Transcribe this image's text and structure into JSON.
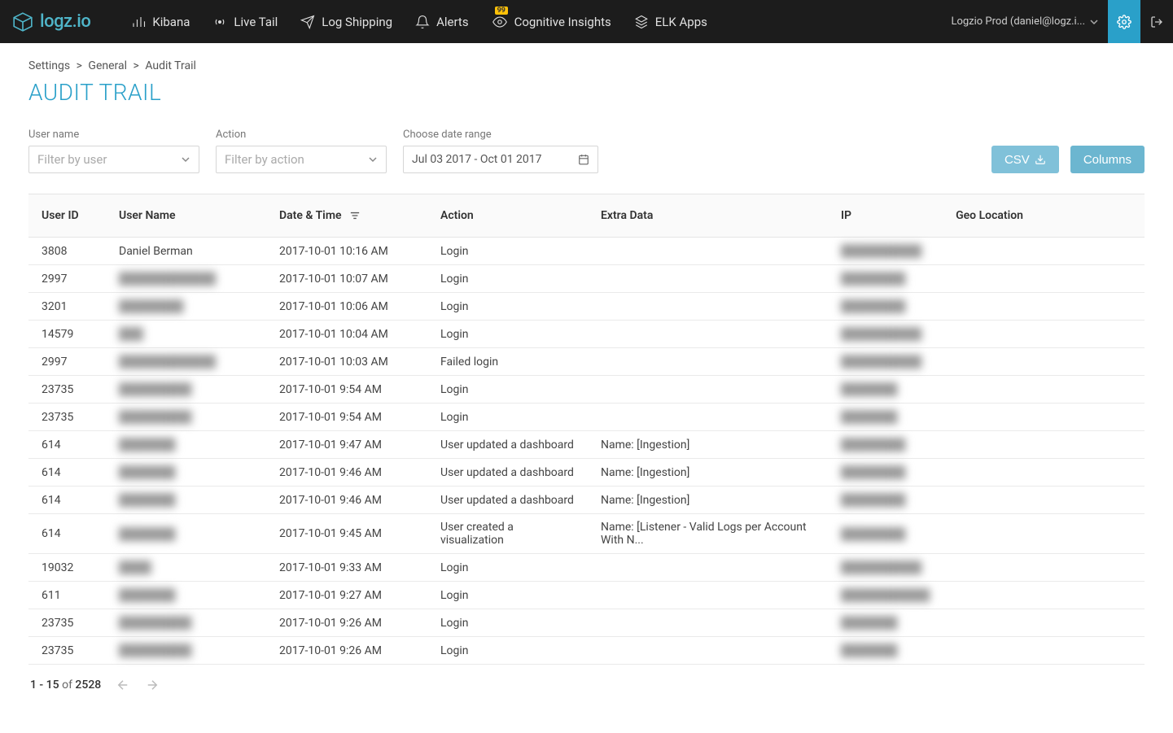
{
  "brand": "logz.io",
  "nav": {
    "items": [
      {
        "label": "Kibana"
      },
      {
        "label": "Live Tail"
      },
      {
        "label": "Log Shipping"
      },
      {
        "label": "Alerts"
      },
      {
        "label": "Cognitive Insights",
        "badge": "99"
      },
      {
        "label": "ELK Apps"
      }
    ],
    "account_label": "Logzio Prod (daniel@logz.i..."
  },
  "breadcrumb": {
    "items": [
      "Settings",
      "General",
      "Audit Trail"
    ]
  },
  "page_title": "AUDIT TRAIL",
  "filters": {
    "user_label": "User name",
    "user_placeholder": "Filter by user",
    "action_label": "Action",
    "action_placeholder": "Filter by action",
    "date_label": "Choose date range",
    "date_value": "Jul 03 2017 - Oct 01 2017"
  },
  "buttons": {
    "csv": "CSV",
    "columns": "Columns"
  },
  "table": {
    "headers": {
      "user_id": "User ID",
      "user_name": "User Name",
      "date_time": "Date & Time",
      "action": "Action",
      "extra_data": "Extra Data",
      "ip": "IP",
      "geo": "Geo Location"
    },
    "rows": [
      {
        "user_id": "3808",
        "user_name": "Daniel Berman",
        "user_blur": false,
        "date_time": "2017-10-01 10:16 AM",
        "action": "Login",
        "extra": "",
        "ip": "██████████",
        "geo": ""
      },
      {
        "user_id": "2997",
        "user_name": "████████████",
        "user_blur": true,
        "date_time": "2017-10-01 10:07 AM",
        "action": "Login",
        "extra": "",
        "ip": "████████",
        "geo": ""
      },
      {
        "user_id": "3201",
        "user_name": "████████",
        "user_blur": true,
        "date_time": "2017-10-01 10:06 AM",
        "action": "Login",
        "extra": "",
        "ip": "████████",
        "geo": ""
      },
      {
        "user_id": "14579",
        "user_name": "███",
        "user_blur": true,
        "date_time": "2017-10-01 10:04 AM",
        "action": "Login",
        "extra": "",
        "ip": "██████████",
        "geo": ""
      },
      {
        "user_id": "2997",
        "user_name": "████████████",
        "user_blur": true,
        "date_time": "2017-10-01 10:03 AM",
        "action": "Failed login",
        "extra": "",
        "ip": "██████████",
        "geo": ""
      },
      {
        "user_id": "23735",
        "user_name": "█████████",
        "user_blur": true,
        "date_time": "2017-10-01 9:54 AM",
        "action": "Login",
        "extra": "",
        "ip": "███████",
        "geo": ""
      },
      {
        "user_id": "23735",
        "user_name": "█████████",
        "user_blur": true,
        "date_time": "2017-10-01 9:54 AM",
        "action": "Login",
        "extra": "",
        "ip": "███████",
        "geo": ""
      },
      {
        "user_id": "614",
        "user_name": "███████",
        "user_blur": true,
        "date_time": "2017-10-01 9:47 AM",
        "action": "User updated a dashboard",
        "extra": "Name: [Ingestion]",
        "ip": "████████",
        "geo": ""
      },
      {
        "user_id": "614",
        "user_name": "███████",
        "user_blur": true,
        "date_time": "2017-10-01 9:46 AM",
        "action": "User updated a dashboard",
        "extra": "Name: [Ingestion]",
        "ip": "████████",
        "geo": ""
      },
      {
        "user_id": "614",
        "user_name": "███████",
        "user_blur": true,
        "date_time": "2017-10-01 9:46 AM",
        "action": "User updated a dashboard",
        "extra": "Name: [Ingestion]",
        "ip": "████████",
        "geo": ""
      },
      {
        "user_id": "614",
        "user_name": "███████",
        "user_blur": true,
        "date_time": "2017-10-01 9:45 AM",
        "action": "User created a visualization",
        "extra": "Name: [Listener - Valid Logs per Account With N...",
        "ip": "████████",
        "geo": ""
      },
      {
        "user_id": "19032",
        "user_name": "████",
        "user_blur": true,
        "date_time": "2017-10-01 9:33 AM",
        "action": "Login",
        "extra": "",
        "ip": "██████████",
        "geo": ""
      },
      {
        "user_id": "611",
        "user_name": "███████",
        "user_blur": true,
        "date_time": "2017-10-01 9:27 AM",
        "action": "Login",
        "extra": "",
        "ip": "███████████",
        "geo": ""
      },
      {
        "user_id": "23735",
        "user_name": "█████████",
        "user_blur": true,
        "date_time": "2017-10-01 9:26 AM",
        "action": "Login",
        "extra": "",
        "ip": "███████",
        "geo": ""
      },
      {
        "user_id": "23735",
        "user_name": "█████████",
        "user_blur": true,
        "date_time": "2017-10-01 9:26 AM",
        "action": "Login",
        "extra": "",
        "ip": "███████",
        "geo": ""
      }
    ]
  },
  "pagination": {
    "range": "1 - 15",
    "of_label": "of",
    "total": "2528"
  }
}
